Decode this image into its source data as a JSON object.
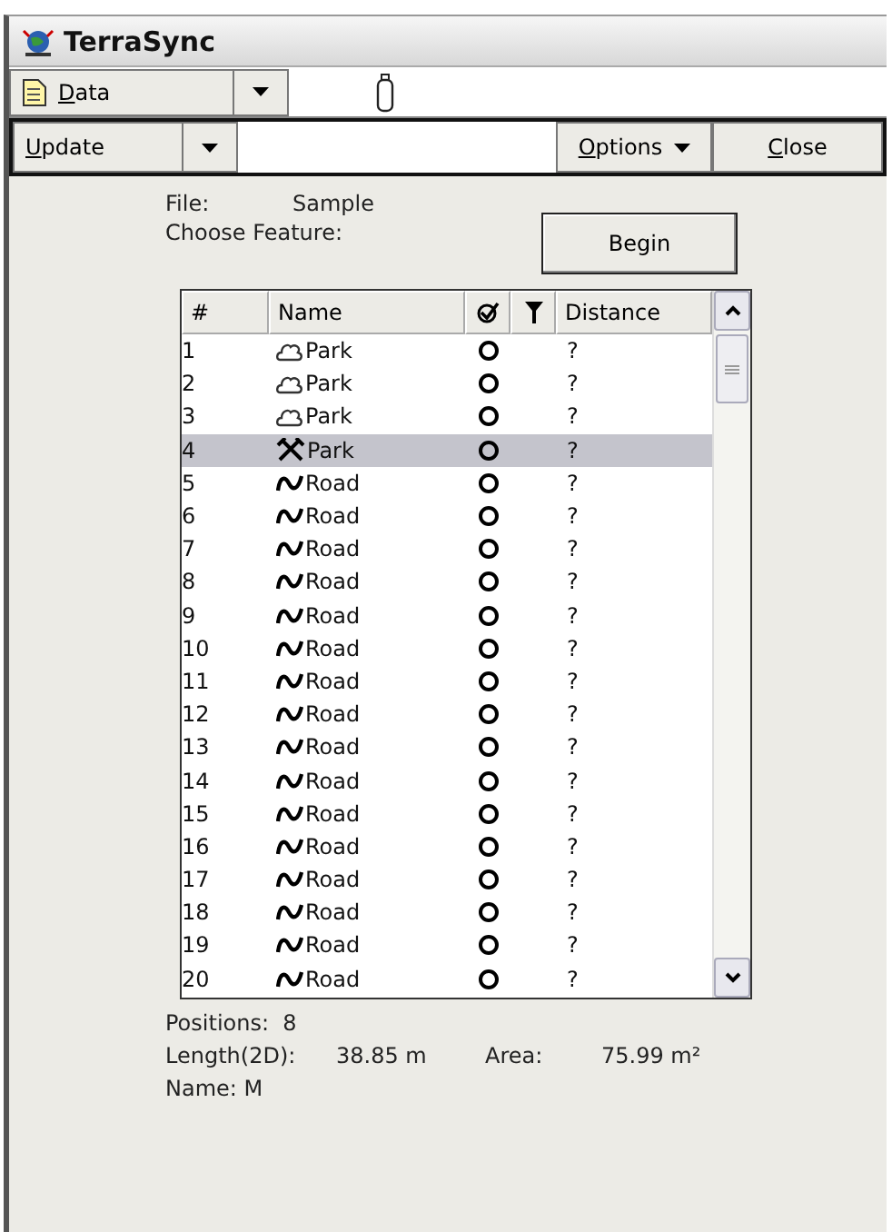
{
  "window": {
    "title": "TerraSync"
  },
  "toolbar": {
    "section": "Data"
  },
  "command_bar": {
    "update": "Update",
    "options": "Options",
    "close": "Close"
  },
  "info": {
    "file_label": "File:",
    "file_value": "Sample",
    "choose_label": "Choose Feature:",
    "begin": "Begin"
  },
  "table": {
    "columns": [
      "#",
      "Name",
      "Distance"
    ],
    "rows": [
      {
        "number": "1",
        "kind": "area",
        "name": "Park",
        "distance": "?",
        "selected": false
      },
      {
        "number": "2",
        "kind": "area",
        "name": "Park",
        "distance": "?",
        "selected": false
      },
      {
        "number": "3",
        "kind": "area",
        "name": "Park",
        "distance": "?",
        "selected": false
      },
      {
        "number": "4",
        "kind": "tool",
        "name": "Park",
        "distance": "?",
        "selected": true
      },
      {
        "number": "5",
        "kind": "line",
        "name": "Road",
        "distance": "?",
        "selected": false
      },
      {
        "number": "6",
        "kind": "line",
        "name": "Road",
        "distance": "?",
        "selected": false
      },
      {
        "number": "7",
        "kind": "line",
        "name": "Road",
        "distance": "?",
        "selected": false
      },
      {
        "number": "8",
        "kind": "line",
        "name": "Road",
        "distance": "?",
        "selected": false
      },
      {
        "number": "9",
        "kind": "line",
        "name": "Road",
        "distance": "?",
        "selected": false
      },
      {
        "number": "10",
        "kind": "line",
        "name": "Road",
        "distance": "?",
        "selected": false
      },
      {
        "number": "11",
        "kind": "line",
        "name": "Road",
        "distance": "?",
        "selected": false
      },
      {
        "number": "12",
        "kind": "line",
        "name": "Road",
        "distance": "?",
        "selected": false
      },
      {
        "number": "13",
        "kind": "line",
        "name": "Road",
        "distance": "?",
        "selected": false
      },
      {
        "number": "14",
        "kind": "line",
        "name": "Road",
        "distance": "?",
        "selected": false
      },
      {
        "number": "15",
        "kind": "line",
        "name": "Road",
        "distance": "?",
        "selected": false
      },
      {
        "number": "16",
        "kind": "line",
        "name": "Road",
        "distance": "?",
        "selected": false
      },
      {
        "number": "17",
        "kind": "line",
        "name": "Road",
        "distance": "?",
        "selected": false
      },
      {
        "number": "18",
        "kind": "line",
        "name": "Road",
        "distance": "?",
        "selected": false
      },
      {
        "number": "19",
        "kind": "line",
        "name": "Road",
        "distance": "?",
        "selected": false
      },
      {
        "number": "20",
        "kind": "line",
        "name": "Road",
        "distance": "?",
        "selected": false
      }
    ]
  },
  "details": {
    "positions": "Positions:  8",
    "length_label": "Length(2D):",
    "length_value": "38.85 m",
    "area_label": "Area:",
    "area_value": "75.99 m²",
    "name": "Name: M"
  }
}
